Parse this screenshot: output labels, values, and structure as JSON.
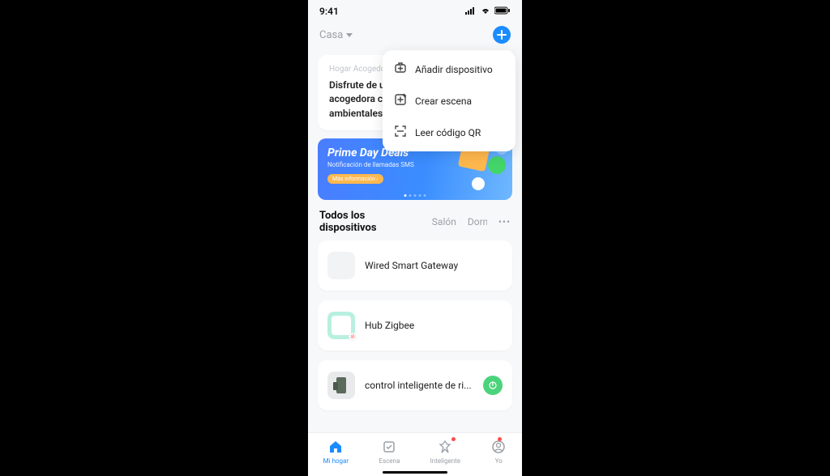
{
  "status": {
    "time": "9:41"
  },
  "header": {
    "home_label": "Casa"
  },
  "dropdown": {
    "items": [
      {
        "label": "Añadir dispositivo"
      },
      {
        "label": "Crear escena"
      },
      {
        "label": "Leer código QR"
      }
    ]
  },
  "welcome_card": {
    "tag": "Hogar Acogedor",
    "text": "Disfrute de una vida hogareña acogedora con indicadores ambientales"
  },
  "banner": {
    "title": "Prime Day Deals",
    "subtitle": "Notificación de llamadas SMS",
    "cta": "Más información ›"
  },
  "room_tabs": {
    "items": [
      "Todos los dispositivos",
      "Salón",
      "Dormitorio"
    ]
  },
  "devices": [
    {
      "name": "Wired Smart Gateway",
      "icon_bg": "#f2f3f5",
      "power": false
    },
    {
      "name": "Hub Zigbee",
      "icon_bg": "#b8f0e0",
      "power": false
    },
    {
      "name": "control inteligente de ri...",
      "icon_bg": "#e8eaec",
      "power": true
    }
  ],
  "nav": {
    "items": [
      {
        "label": "Mi hogar"
      },
      {
        "label": "Escena"
      },
      {
        "label": "Inteligente"
      },
      {
        "label": "Yo"
      }
    ]
  }
}
